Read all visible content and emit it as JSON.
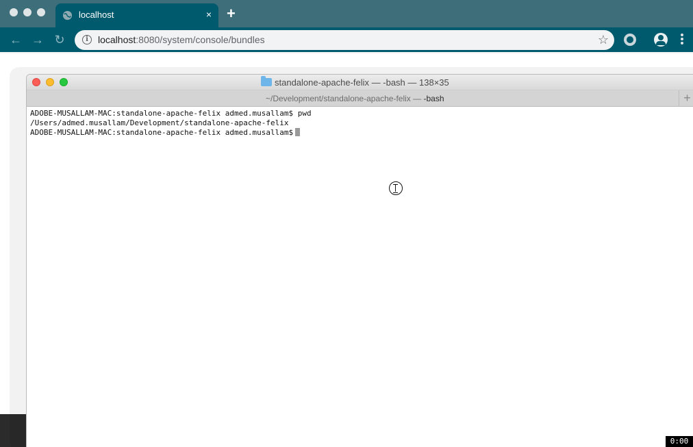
{
  "browser": {
    "tab_title": "localhost",
    "tab_close": "×",
    "new_tab": "+",
    "back": "←",
    "forward": "→",
    "reload": "↻",
    "url_host": "localhost",
    "url_path": ":8080/system/console/bundles",
    "info": "i",
    "star": "☆"
  },
  "terminal": {
    "window_title": "standalone-apache-felix — -bash — 138×35",
    "tab_path": "~/Development/standalone-apache-felix — ",
    "tab_shell": "-bash",
    "new_tab": "+",
    "lines": [
      "ADOBE-MUSALLAM-MAC:standalone-apache-felix admed.musallam$ pwd",
      "/Users/admed.musallam/Development/standalone-apache-felix",
      "ADOBE-MUSALLAM-MAC:standalone-apache-felix admed.musallam$"
    ]
  },
  "overlay": {
    "timer": "0:00"
  },
  "colors": {
    "chrome_teal": "#005a6e",
    "tabstrip": "#3e6e7a",
    "traffic_red": "#fd5f57",
    "traffic_yellow": "#febc2e",
    "traffic_green": "#28c840"
  }
}
